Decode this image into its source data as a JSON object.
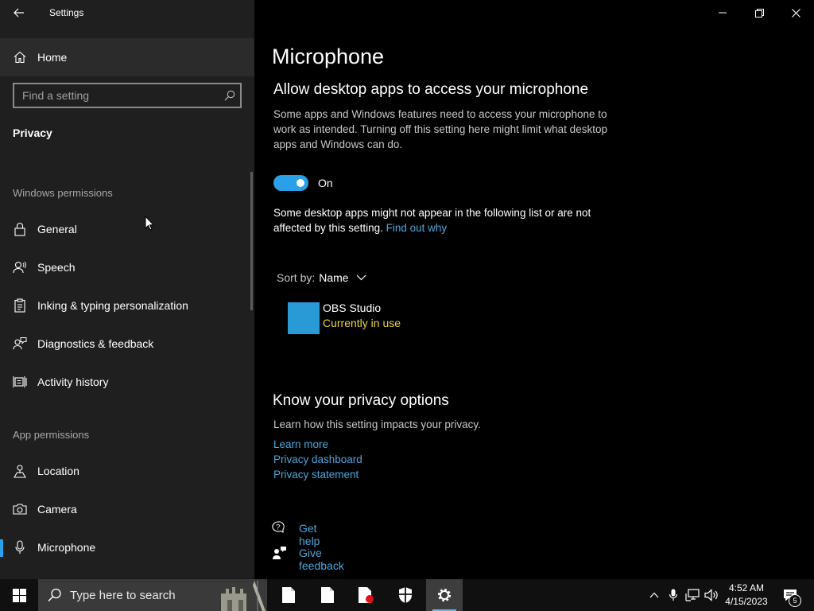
{
  "window": {
    "title": "Settings"
  },
  "sidebar": {
    "home_label": "Home",
    "search_placeholder": "Find a setting",
    "section_title": "Privacy",
    "windows_permissions_header": "Windows permissions",
    "windows_items": [
      {
        "label": "General",
        "icon": "lock-icon"
      },
      {
        "label": "Speech",
        "icon": "speech-icon"
      },
      {
        "label": "Inking & typing personalization",
        "icon": "clipboard-icon"
      },
      {
        "label": "Diagnostics & feedback",
        "icon": "feedback-icon"
      },
      {
        "label": "Activity history",
        "icon": "timeline-icon"
      }
    ],
    "app_permissions_header": "App permissions",
    "app_items": [
      {
        "label": "Location",
        "icon": "location-icon"
      },
      {
        "label": "Camera",
        "icon": "camera-icon"
      },
      {
        "label": "Microphone",
        "icon": "microphone-icon",
        "selected": true
      }
    ]
  },
  "main": {
    "page_title": "Microphone",
    "subtitle": "Allow desktop apps to access your microphone",
    "description": "Some apps and Windows features need to access your microphone to work as intended. Turning off this setting here might limit what desktop apps and Windows can do.",
    "toggle": {
      "state": "On",
      "on": true
    },
    "note": "Some desktop apps might not appear in the following list or are not affected by this setting.",
    "note_link": "Find out why",
    "sort": {
      "label": "Sort by:",
      "value": "Name"
    },
    "apps": [
      {
        "name": "OBS Studio",
        "status": "Currently in use",
        "tile_color": "#2a9ad6"
      }
    ],
    "privacy": {
      "title": "Know your privacy options",
      "description": "Learn how this setting impacts your privacy.",
      "links": [
        "Learn more",
        "Privacy dashboard",
        "Privacy statement"
      ]
    },
    "help": {
      "get_help": "Get help",
      "give_feedback": "Give feedback"
    }
  },
  "taskbar": {
    "search_placeholder": "Type here to search",
    "pinned": [
      "file-explorer-icon",
      "document-icon",
      "pdf-icon",
      "security-icon",
      "settings-gear-icon"
    ],
    "clock": {
      "time": "4:52 AM",
      "date": "4/15/2023"
    },
    "notification_count": "5"
  },
  "colors": {
    "accent": "#29a0e8",
    "link": "#4ea5dc",
    "status_in_use": "#e6d34a",
    "sidebar_bg": "#1f1f1f",
    "main_bg": "#000000"
  }
}
